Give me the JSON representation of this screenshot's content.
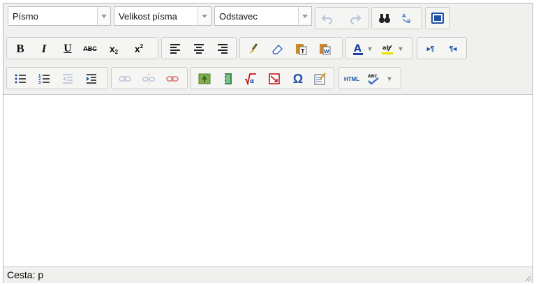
{
  "toolbar1": {
    "font_family": "Písmo",
    "font_size": "Velikost písma",
    "format": "Odstavec",
    "undo_icon": "undo-icon",
    "redo_icon": "redo-icon",
    "search_icon": "binoculars-icon",
    "replace_icon": "replace-icon",
    "fullscreen_icon": "fullscreen-icon"
  },
  "toolbar2": {
    "bold": "B",
    "italic": "I",
    "underline": "U",
    "strike": "ABC",
    "sub": "x",
    "sup": "x",
    "icons": [
      "align-left-icon",
      "align-center-icon",
      "align-right-icon",
      "cleanup-brush-icon",
      "eraser-icon",
      "paste-text-icon",
      "paste-word-icon",
      "text-color-icon",
      "highlight-color-icon",
      "ltr-icon",
      "rtl-icon"
    ]
  },
  "toolbar3": {
    "html_label": "HTML",
    "abc_label": "ABC",
    "icons": [
      "bullet-list-icon",
      "numbered-list-icon",
      "outdent-icon",
      "indent-icon",
      "link-icon",
      "unlink-icon",
      "anchor-icon",
      "image-icon",
      "media-icon",
      "equation-icon",
      "nonbreaking-icon",
      "omega-icon",
      "edit-icon",
      "spellcheck-icon"
    ]
  },
  "status": {
    "path": "Cesta: p"
  },
  "colors": {
    "accent": "#1d4fa5",
    "text_color": "#1a3fa0",
    "highlight": "#e8e000",
    "disabled": "#b9c5d8"
  }
}
